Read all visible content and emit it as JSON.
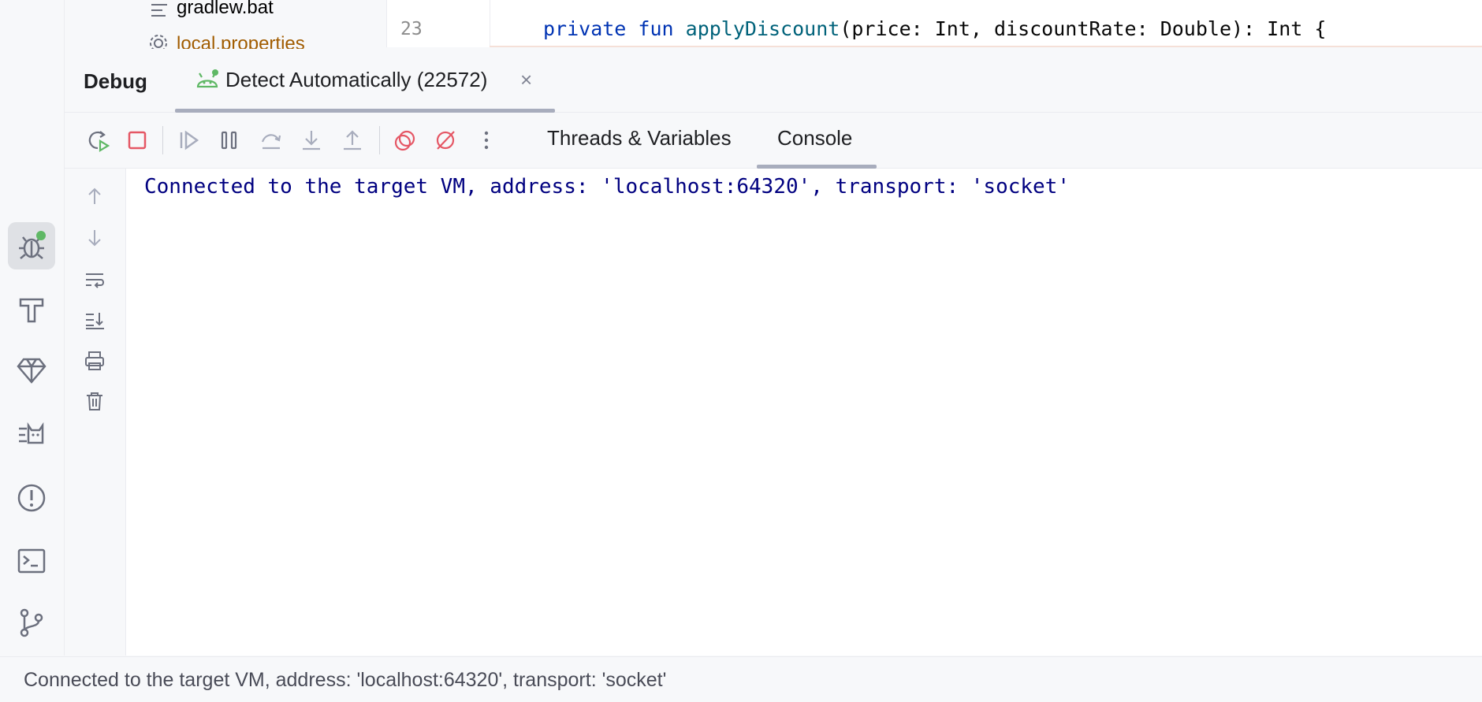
{
  "project_tree": {
    "items": [
      {
        "label": "gradlew.bat",
        "icon": "text-file-icon"
      },
      {
        "label": "local.properties",
        "icon": "gear-icon"
      }
    ]
  },
  "editor": {
    "line_number": "23",
    "code": {
      "kw1": "private",
      "kw2": "fun",
      "fn": "applyDiscount",
      "rest": "(price: Int, discountRate: Double): Int {"
    }
  },
  "debug": {
    "title": "Debug",
    "session": {
      "label": "Detect Automatically (22572)",
      "close": "×"
    },
    "toolbar": [
      "rerun-icon",
      "stop-icon",
      "resume-icon",
      "pause-icon",
      "step-over-icon",
      "step-into-icon",
      "step-out-icon",
      "view-breakpoints-icon",
      "mute-breakpoints-icon",
      "more-icon"
    ],
    "tabs": [
      "Threads & Variables",
      "Console"
    ],
    "active_tab": "Console"
  },
  "console": {
    "line": "Connected to the target VM, address: 'localhost:64320', transport: 'socket'"
  },
  "side_tools": [
    "up-arrow-icon",
    "down-arrow-icon",
    "soft-wrap-icon",
    "scroll-to-end-icon",
    "print-icon",
    "clear-all-icon"
  ],
  "tool_strip": [
    "debug-icon",
    "build-icon",
    "gem-icon",
    "cat-icon",
    "problems-icon",
    "terminal-icon",
    "git-icon"
  ],
  "status_bar": {
    "text": "Connected to the target VM, address: 'localhost:64320', transport: 'socket'"
  },
  "colors": {
    "accent_green": "#5fb865",
    "stop_red": "#e55765",
    "console_text": "#000080"
  }
}
